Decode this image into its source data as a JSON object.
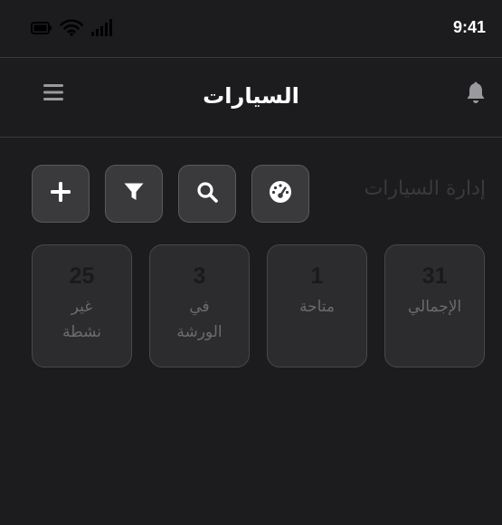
{
  "status_bar": {
    "time": "9:41",
    "icons": [
      "battery-icon",
      "wifi-icon",
      "signal-icon"
    ]
  },
  "header": {
    "title": "السيارات",
    "menu_icon": "menu-icon",
    "notification_icon": "bell-icon"
  },
  "section": {
    "title": "إدارة السيارات"
  },
  "actions": [
    {
      "icon": "plus-icon"
    },
    {
      "icon": "filter-icon"
    },
    {
      "icon": "search-icon"
    },
    {
      "icon": "dashboard-icon"
    }
  ],
  "stats": {
    "inactive": {
      "value": "25",
      "label": "غير نشطة"
    },
    "workshop": {
      "value": "3",
      "label": "في الورشة"
    },
    "available": {
      "value": "1",
      "label": "متاحة"
    },
    "total": {
      "value": "31",
      "label": "الإجمالي"
    }
  },
  "colors": {
    "background": "#1c1c1e",
    "card": "#2c2c2e",
    "button": "#3a3a3c",
    "divider": "#3a3a3c",
    "text_primary": "#ffffff",
    "text_muted": "#6a6a70"
  }
}
